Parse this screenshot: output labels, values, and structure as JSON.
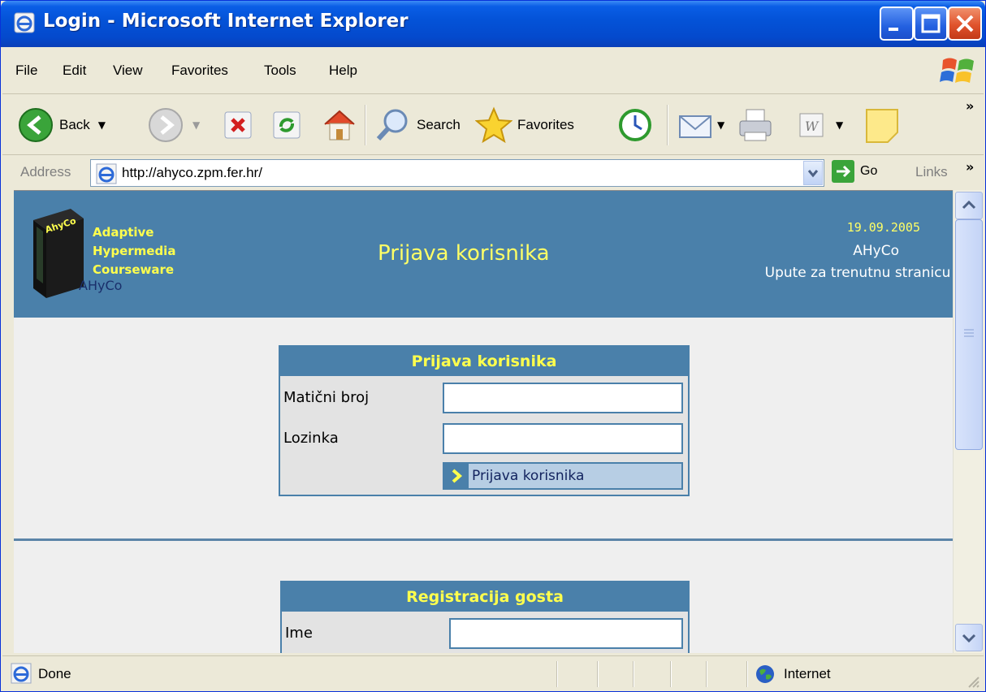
{
  "window": {
    "title": "Login - Microsoft Internet Explorer"
  },
  "menu": {
    "items": [
      "File",
      "Edit",
      "View",
      "Favorites",
      "Tools",
      "Help"
    ]
  },
  "toolbar": {
    "back_label": "Back",
    "search_label": "Search",
    "favorites_label": "Favorites",
    "overflow": "»"
  },
  "address": {
    "label": "Address",
    "url": "http://ahyco.zpm.fer.hr/",
    "go_label": "Go",
    "links_label": "Links"
  },
  "banner": {
    "logo_lines": [
      "Adaptive",
      "Hypermedia",
      "Courseware"
    ],
    "logo_book_text": "AhyCo",
    "logo_name": "AHyCo",
    "title": "Prijava korisnika",
    "date": "19.09.2005",
    "app_name": "AHyCo",
    "help_link": "Upute za trenutnu stranicu"
  },
  "login": {
    "heading": "Prijava korisnika",
    "id_label": "Matični broj",
    "id_value": "",
    "password_label": "Lozinka",
    "password_value": "",
    "submit_label": "Prijava korisnika"
  },
  "register": {
    "heading": "Registracija gosta",
    "name_label": "Ime",
    "name_value": ""
  },
  "status": {
    "text": "Done",
    "zone": "Internet"
  },
  "colors": {
    "banner": "#4a80aa",
    "accent_yellow": "#ffff4d",
    "page_bg": "#efefef"
  }
}
